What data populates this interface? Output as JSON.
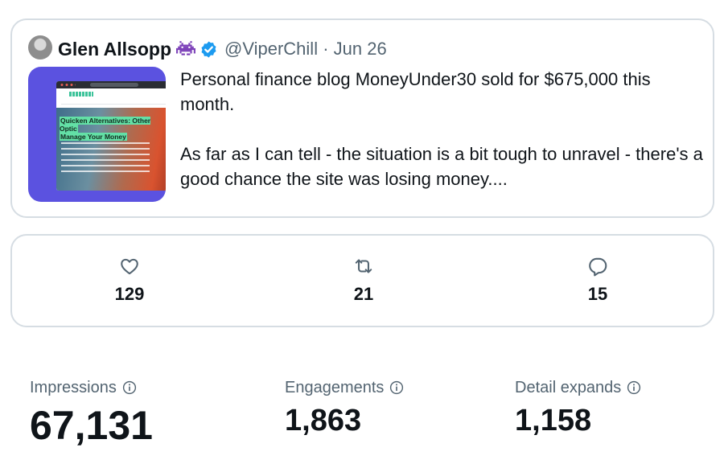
{
  "tweet": {
    "author_name": "Glen Allsopp",
    "handle_and_date": "@ViperChill · Jun 26",
    "text_paragraph_1": "Personal finance blog MoneyUnder30 sold for $675,000 this month.",
    "text_paragraph_2": "As far as I can tell - the situation is a bit tough to unravel - there's a good chance the site was losing money....",
    "thumbnail_heading_line_1": "Quicken Alternatives: Other Optic",
    "thumbnail_heading_line_2": "Manage Your Money"
  },
  "actions": [
    {
      "name": "like",
      "icon": "heart-icon",
      "count": "129"
    },
    {
      "name": "retweet",
      "icon": "retweet-icon",
      "count": "21"
    },
    {
      "name": "reply",
      "icon": "reply-icon",
      "count": "15"
    }
  ],
  "stats": [
    {
      "label": "Impressions",
      "value": "67,131"
    },
    {
      "label": "Engagements",
      "value": "1,863"
    },
    {
      "label": "Detail expands",
      "value": "1,158"
    }
  ],
  "colors": {
    "text": "#0f1419",
    "secondary_text": "#536471",
    "border": "#d6dde3",
    "verified_blue": "#1d9bf0",
    "thumbnail_purple": "#5b52e0",
    "invader_purple": "#7b3fb8"
  }
}
